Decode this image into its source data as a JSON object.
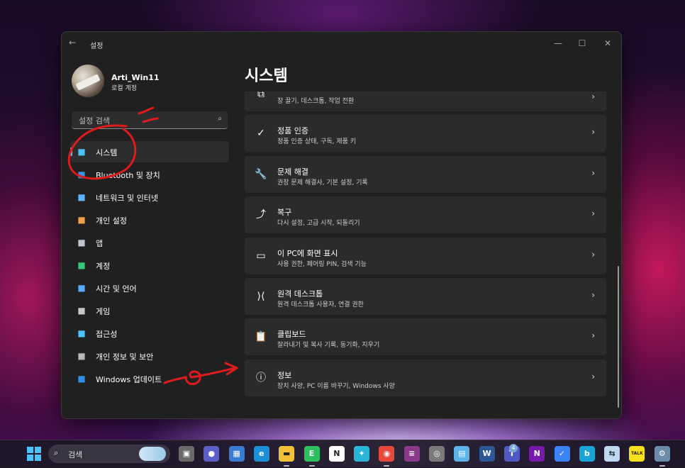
{
  "window": {
    "title": "설정",
    "back_icon": "←",
    "controls": {
      "minimize": "—",
      "maximize": "☐",
      "close": "✕"
    }
  },
  "profile": {
    "name": "Arti_Win11",
    "account_type": "로컬 계정"
  },
  "search": {
    "placeholder": "설정 검색",
    "icon": "⌕"
  },
  "nav": {
    "items": [
      {
        "label": "시스템",
        "icon": "system-icon",
        "color": "#4cc2ff",
        "active": true
      },
      {
        "label": "Bluetooth 및 장치",
        "icon": "bluetooth-icon",
        "color": "#3a8ee6"
      },
      {
        "label": "네트워크 및 인터넷",
        "icon": "wifi-icon",
        "color": "#5fb3ff"
      },
      {
        "label": "개인 설정",
        "icon": "brush-icon",
        "color": "#f0a24b"
      },
      {
        "label": "앱",
        "icon": "apps-icon",
        "color": "#bfc7d1"
      },
      {
        "label": "계정",
        "icon": "account-icon",
        "color": "#38c976"
      },
      {
        "label": "시간 및 언어",
        "icon": "globe-clock-icon",
        "color": "#5aa9ff"
      },
      {
        "label": "게임",
        "icon": "controller-icon",
        "color": "#c9c9c9"
      },
      {
        "label": "접근성",
        "icon": "accessibility-icon",
        "color": "#4cc2ff"
      },
      {
        "label": "개인 정보 및 보안",
        "icon": "shield-icon",
        "color": "#b8b8b8"
      },
      {
        "label": "Windows 업데이트",
        "icon": "update-icon",
        "color": "#2f8fe6"
      }
    ]
  },
  "main": {
    "page_title": "시스템",
    "cards": [
      {
        "title": "",
        "desc": "창 끌기, 데스크톱, 작업 전환",
        "icon": "multitasking-icon",
        "glyph": "⧉"
      },
      {
        "title": "정품 인증",
        "desc": "정품 인증 상태, 구독, 제품 키",
        "icon": "check-circle-icon",
        "glyph": "✓"
      },
      {
        "title": "문제 해결",
        "desc": "권장 문제 해결사, 기본 설정, 기록",
        "icon": "wrench-icon",
        "glyph": "🔧"
      },
      {
        "title": "복구",
        "desc": "다시 설정, 고급 시작, 되돌리기",
        "icon": "recovery-icon",
        "glyph": "⤴"
      },
      {
        "title": "이 PC에 화면 표시",
        "desc": "사용 권한, 페어링 PIN, 검색 기능",
        "icon": "project-icon",
        "glyph": "▭"
      },
      {
        "title": "원격 데스크톱",
        "desc": "원격 데스크톱 사용자, 연결 권한",
        "icon": "remote-desktop-icon",
        "glyph": "⟩⟨"
      },
      {
        "title": "클립보드",
        "desc": "잘라내기 및 복사 기록, 동기화, 지우기",
        "icon": "clipboard-icon",
        "glyph": "📋"
      },
      {
        "title": "정보",
        "desc": "장치 사양, PC 이름 바꾸기, Windows 사양",
        "icon": "info-icon",
        "glyph": "ⓘ"
      }
    ],
    "chevron": "›"
  },
  "taskbar": {
    "search_label": "검색",
    "search_icon": "⌕",
    "apps": [
      {
        "name": "task-view",
        "glyph": "▣",
        "color": "#6a6a6a"
      },
      {
        "name": "teams-chat",
        "glyph": "●",
        "color": "#5b5fc7"
      },
      {
        "name": "microsoft-store",
        "glyph": "▦",
        "color": "#3b7bd1"
      },
      {
        "name": "edge",
        "glyph": "e",
        "color": "#1d8fd6"
      },
      {
        "name": "file-explorer",
        "glyph": "▬",
        "color": "#f2c037"
      },
      {
        "name": "evernote",
        "glyph": "E",
        "color": "#2dbe60"
      },
      {
        "name": "notion",
        "glyph": "N",
        "color": "#ffffff"
      },
      {
        "name": "bird-app",
        "glyph": "✦",
        "color": "#29b6d8"
      },
      {
        "name": "chrome",
        "glyph": "◉",
        "color": "#e5493a"
      },
      {
        "name": "winrar",
        "glyph": "≡",
        "color": "#8b3a8b"
      },
      {
        "name": "photos",
        "glyph": "◎",
        "color": "#7a7a7a"
      },
      {
        "name": "notepad",
        "glyph": "▤",
        "color": "#5fb3e8"
      },
      {
        "name": "word",
        "glyph": "W",
        "color": "#2b5797"
      },
      {
        "name": "teams",
        "glyph": "T",
        "color": "#4f5ac5"
      },
      {
        "name": "onenote",
        "glyph": "N",
        "color": "#7719aa"
      },
      {
        "name": "todo",
        "glyph": "✓",
        "color": "#3b82f6"
      },
      {
        "name": "bing",
        "glyph": "b",
        "color": "#1aa3d6"
      },
      {
        "name": "vpn",
        "glyph": "⇆",
        "color": "#c0d8ef"
      },
      {
        "name": "kakaotalk",
        "glyph": "TALK",
        "color": "#f7e11a"
      },
      {
        "name": "settings",
        "glyph": "⚙",
        "color": "#6a8ca8"
      }
    ],
    "badge": "4"
  },
  "colors": {
    "accent": "#4cc2ff",
    "window_bg": "#202020",
    "card_bg": "#2b2b2b",
    "annotation": "#e01b1b"
  }
}
